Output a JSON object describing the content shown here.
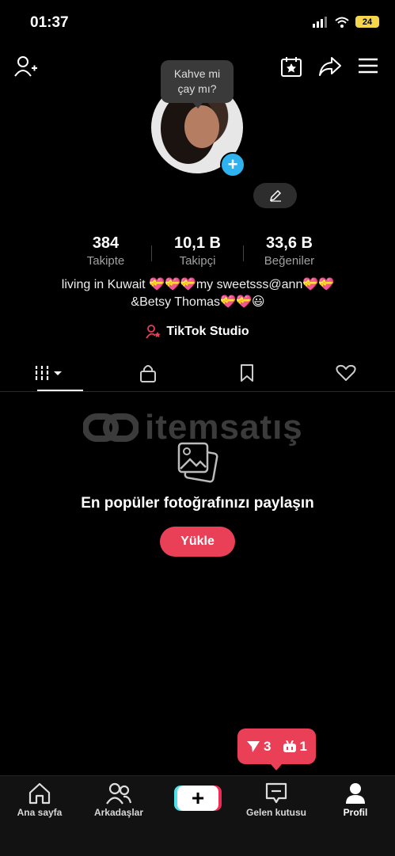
{
  "status_bar": {
    "time": "01:37",
    "battery": "24"
  },
  "tooltip": {
    "text_line1": "Kahve mi",
    "text_line2": "çay mı?"
  },
  "profile": {
    "handle_masked": "",
    "stats": [
      {
        "value": "384",
        "label": "Takipte"
      },
      {
        "value": "10,1 B",
        "label": "Takipçi"
      },
      {
        "value": "33,6 B",
        "label": "Beğeniler"
      }
    ],
    "bio_line1": "living in Kuwait 💝💝💝my sweetsss@ann💝💝",
    "bio_line2": "&Betsy Thomas💝💝😃",
    "studio_label": "TikTok Studio"
  },
  "watermark": {
    "text": "itemsatış"
  },
  "empty_state": {
    "title": "En popüler fotoğrafınızı paylaşın",
    "button": "Yükle"
  },
  "notifications": {
    "messages_count": "3",
    "bot_count": "1"
  },
  "bottom_nav": [
    {
      "label": "Ana sayfa",
      "icon": "home-icon"
    },
    {
      "label": "Arkadaşlar",
      "icon": "friends-icon"
    },
    {
      "label": "",
      "icon": "create-icon"
    },
    {
      "label": "Gelen kutusu",
      "icon": "inbox-icon"
    },
    {
      "label": "Profil",
      "icon": "profile-icon"
    }
  ],
  "colors": {
    "accent": "#e94057",
    "background": "#000000"
  }
}
